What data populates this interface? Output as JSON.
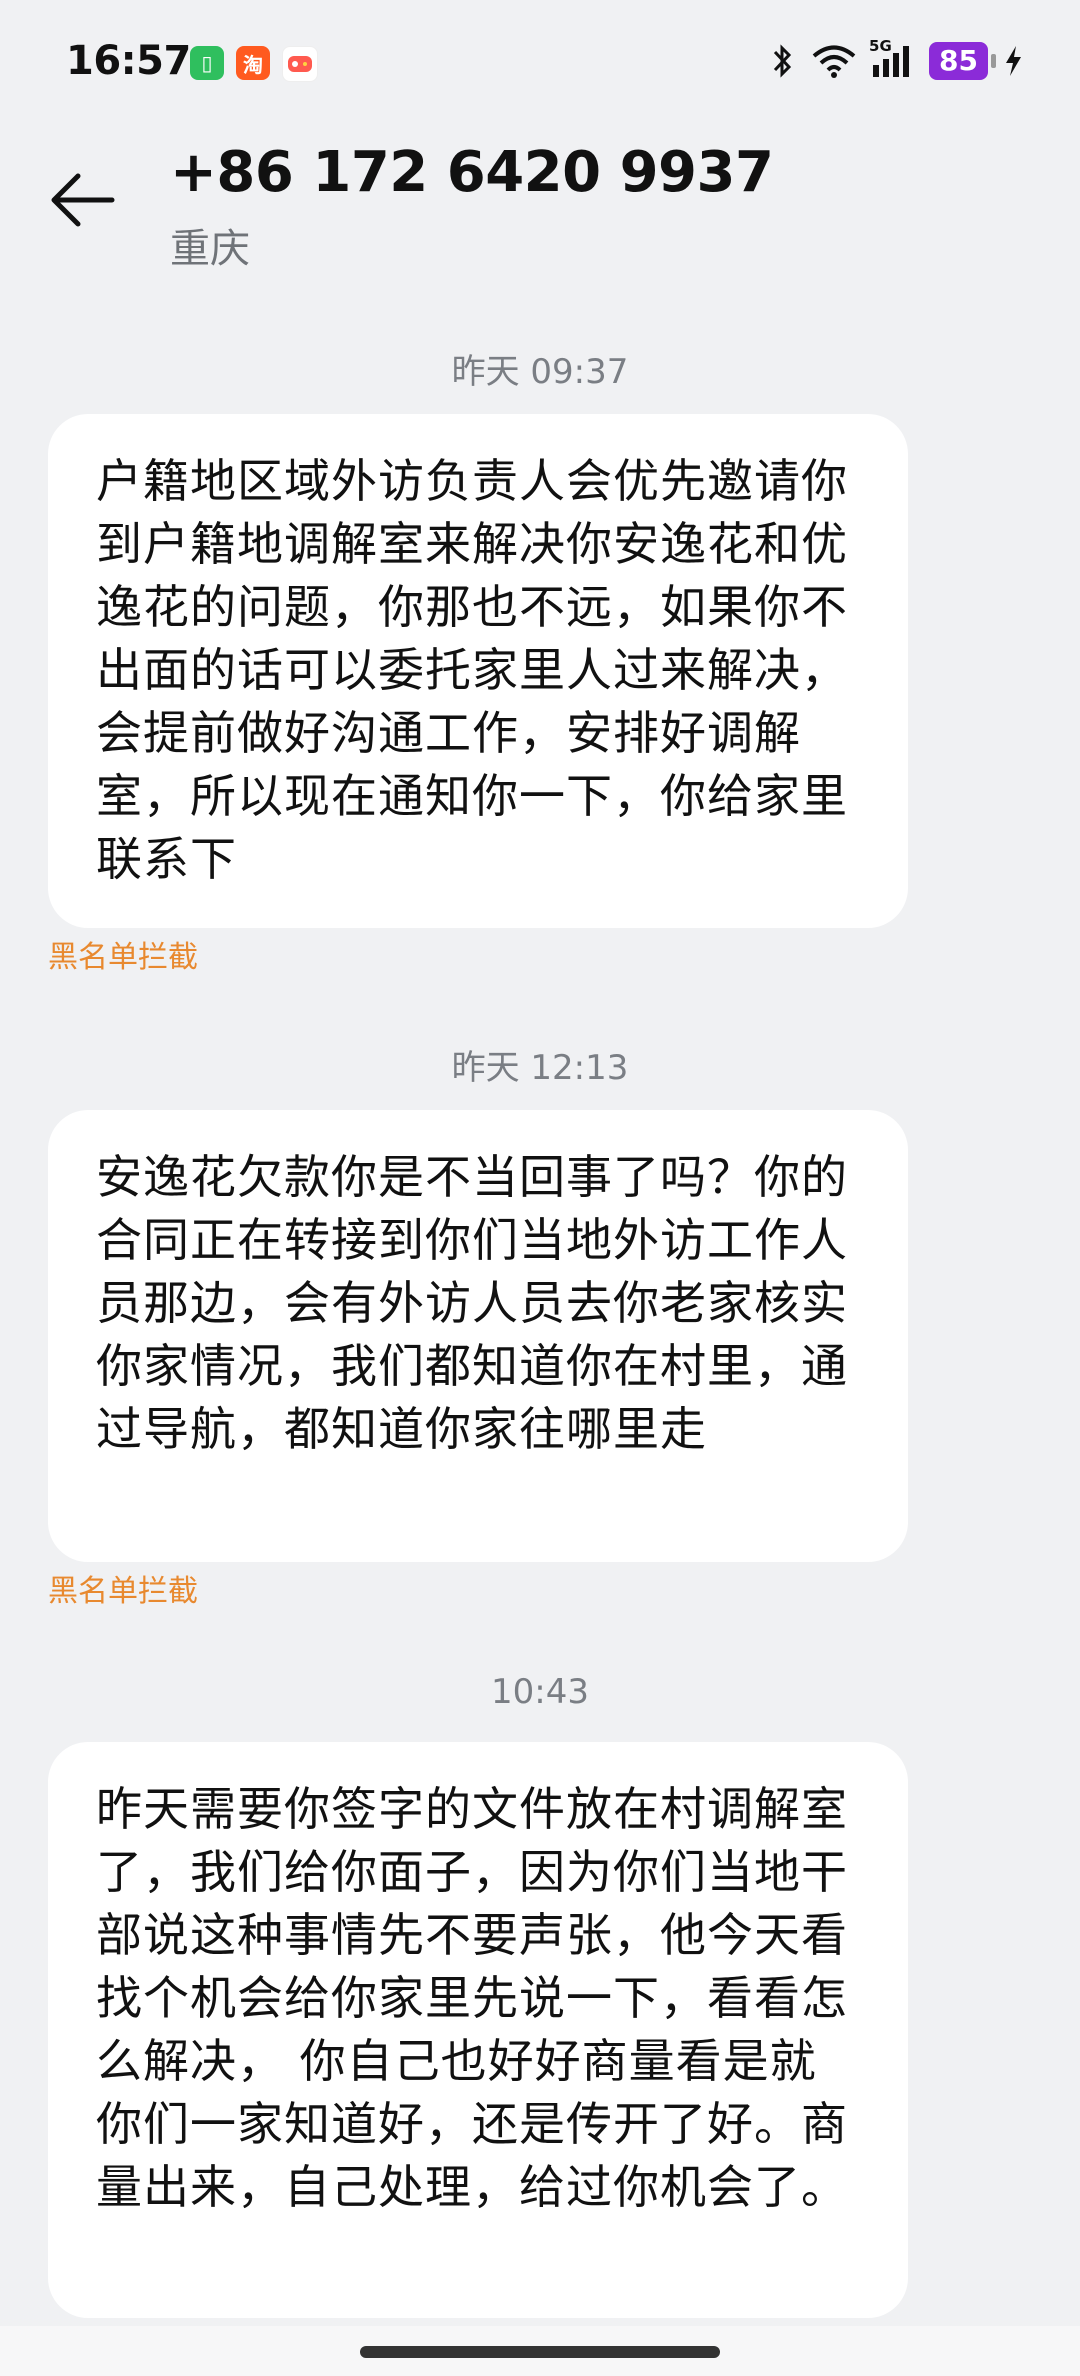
{
  "status_bar": {
    "time": "16:57",
    "app_icon_1": "▯",
    "app_icon_2": "淘",
    "app_icon_3": "",
    "signal_label": "5G",
    "battery": "85"
  },
  "header": {
    "phone_number": "+86 172 6420 9937",
    "location": "重庆"
  },
  "messages": [
    {
      "timestamp": "昨天 09:37",
      "text": "户籍地区域外访负责人会优先邀请你到户籍地调解室来解决你安逸花和优逸花的问题，你那也不远，如果你不出面的话可以委托家里人过来解决，会提前做好沟通工作，安排好调解室，所以现在通知你一下，你给家里联系下",
      "status": "黑名单拦截"
    },
    {
      "timestamp": "昨天 12:13",
      "text": "安逸花欠款你是不当回事了吗？你的合同正在转接到你们当地外访工作人员那边，会有外访人员去你老家核实你家情况，我们都知道你在村里，通过导航，都知道你家往哪里走",
      "status": "黑名单拦截"
    },
    {
      "timestamp": "10:43",
      "text": "昨天需要你签字的文件放在村调解室了，我们给你面子，因为你们当地干部说这种事情先不要声张，他今天看找个机会给你家里先说一下，看看怎么解决， 你自己也好好商量看是就你们一家知道好，还是传开了好。商量出来，自己处理，给过你机会了。"
    }
  ],
  "colors": {
    "background": "#f0f1f3",
    "bubble": "#ffffff",
    "blocked_label": "#e8892f",
    "battery": "#8b2bd8"
  }
}
